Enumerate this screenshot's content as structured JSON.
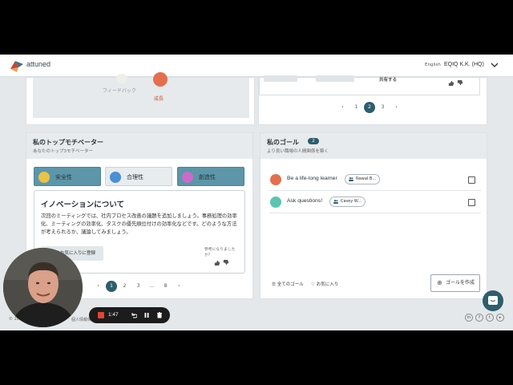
{
  "header": {
    "brand": "attuned",
    "language": "English",
    "organization": "EQIQ K.K. (HQ)",
    "accent_color": "#2e5d6b"
  },
  "top_left_card": {
    "feedback_label": "フィードバック",
    "growth_label": "成長"
  },
  "top_right_card": {
    "share_label": "共有する"
  },
  "top_pager": {
    "pages": [
      "1",
      "2",
      "3"
    ],
    "current": "2"
  },
  "motivators": {
    "title": "私のトップモチベーター",
    "subtitle": "あなたのトップ3モチベーター",
    "tabs": [
      {
        "label": "安全性",
        "icon": "shield-icon",
        "color": "#e8c34a"
      },
      {
        "label": "合理性",
        "icon": "magnifier-icon",
        "color": "#4a8fd4"
      },
      {
        "label": "創造性",
        "icon": "lightbulb-icon",
        "color": "#c76dc9"
      }
    ],
    "detail": {
      "title": "イノベーションについて",
      "body": "次回のミーティングでは、社内プロセス改善の議題を追加しましょう。事務処理の効率化、ミーティングの効率化、タスクの優先順位付けの効率化などです。どのような方法が考えられるか、議論してみましょう。",
      "favorite_button": "お気に入りに登録",
      "helpful_prompt": "参考になりましたか？"
    },
    "pager": {
      "pages": [
        "1",
        "2",
        "3",
        "...",
        "8"
      ],
      "current": "1"
    }
  },
  "goals": {
    "title": "私のゴール",
    "count": "2",
    "subtitle": "より良い職場の人間関係を築く",
    "items": [
      {
        "text": "Be a life-long learner",
        "owner": "Nawal B...",
        "icon_color": "#e2704f"
      },
      {
        "text": "Ask questions!",
        "owner": "Casey W...",
        "icon_color": "#5cc4b0"
      }
    ],
    "all_goals_link": "全てのゴール",
    "favorites_link": "お気に入り",
    "create_button": "ゴールを作成"
  },
  "footer": {
    "copyright": "© 2024",
    "policy": "個人情報保護方針"
  },
  "recorder": {
    "elapsed": "1:47"
  }
}
